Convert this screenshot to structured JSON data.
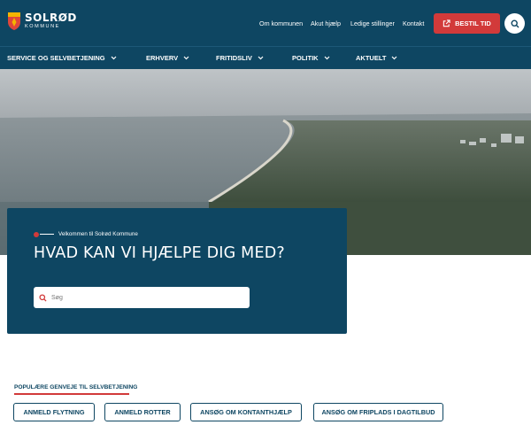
{
  "header": {
    "logo_name": "SOLRØD",
    "logo_sub": "KOMMUNE",
    "top_links": [
      "Om kommunen",
      "Akut hjælp",
      "Ledige stillinger",
      "Kontakt"
    ],
    "cta_label": "BESTIL TID",
    "search_icon": "search-icon"
  },
  "nav": {
    "items": [
      {
        "label": "SERVICE OG SELVBETJENING"
      },
      {
        "label": "ERHVERV"
      },
      {
        "label": "FRITIDSLIV"
      },
      {
        "label": "POLITIK"
      },
      {
        "label": "AKTUELT"
      }
    ]
  },
  "hero": {
    "welcome": "Velkommen til Solrød Kommune",
    "headline": "HVAD KAN VI HJÆLPE DIG MED?",
    "search_placeholder": "Søg"
  },
  "popular": {
    "heading": "POPULÆRE GENVEJE TIL SELVBETJENING",
    "buttons": [
      "ANMELD FLYTNING",
      "ANMELD ROTTER",
      "ANSØG OM KONTANTHJÆLP",
      "ANSØG OM FRIPLADS I DAGTILBUD"
    ]
  },
  "colors": {
    "brand_navy": "#0e4662",
    "accent_red": "#d23a3a"
  }
}
